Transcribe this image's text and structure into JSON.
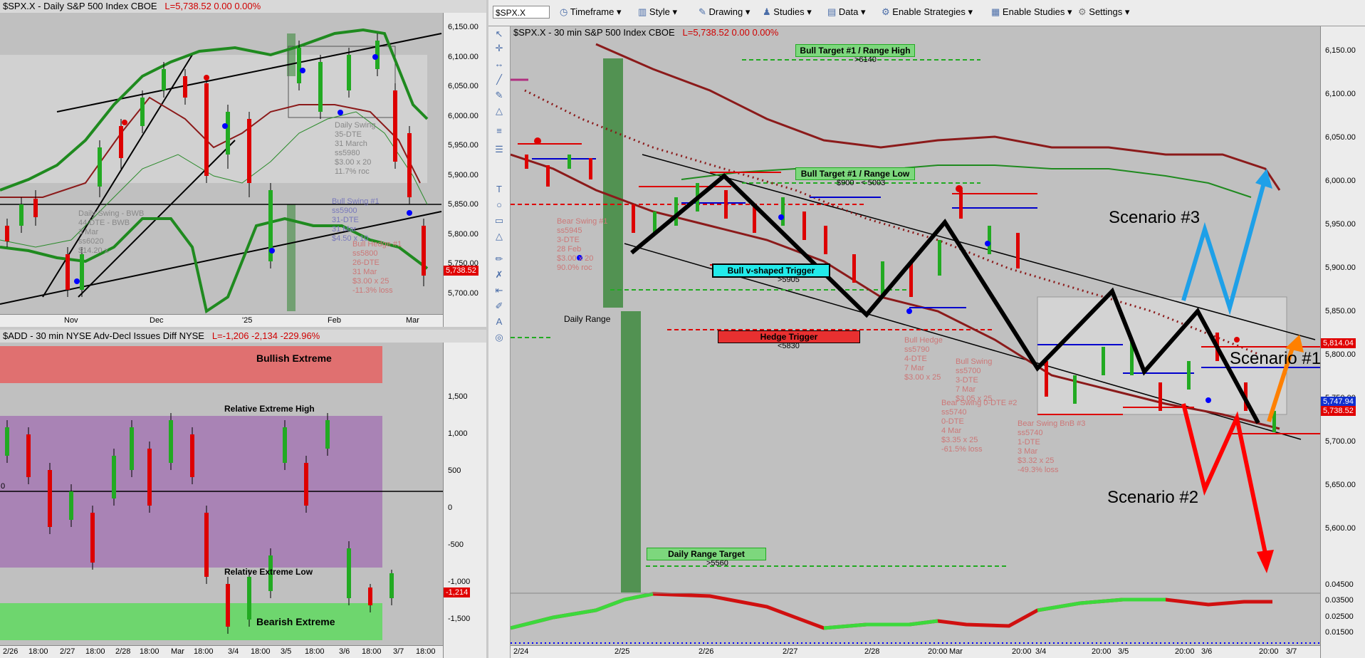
{
  "left_top": {
    "symbol": "$SPX.X - Daily  S&P 500 Index  CBOE",
    "last": "L=5,738.52  0.00  0.00%",
    "y_labels": [
      "6,150.00",
      "6,100.00",
      "6,050.00",
      "6,000.00",
      "5,950.00",
      "5,900.00",
      "5,850.00",
      "5,800.00",
      "5,750.00",
      "5,700.00"
    ],
    "price_tag": "5,738.52",
    "x_labels": [
      "Nov",
      "Dec",
      "'25",
      "Feb",
      "Mar"
    ],
    "notes": {
      "daily_swing_a": "Daily Swing\n35-DTE\n31 March\nss5980\n$3.00 x 20\n11.7% roc",
      "daily_swing_b": "Daily Swing - BWB\n44 DTE - BWB\n3 Mar\nss6020\n$14.20 x",
      "bull_swing": "Bull Swing #1\nss5900\n31-DTE\n31 Mar\n$4.50 x 10",
      "bull_hedge": "Bull Hedge #1\nss5800\n26-DTE\n31 Mar\n$3.00 x 25\n-11.3% loss"
    }
  },
  "left_bottom": {
    "symbol": "$ADD - 30 min  NYSE Adv-Decl Issues Diff  NYSE",
    "last": "L=-1,206  -2,134  -229.96%",
    "y_labels": [
      "1,500",
      "1,000",
      "500",
      "0",
      "-500",
      "-1,000",
      "-1,500"
    ],
    "price_tag": "-1,214",
    "zero_marker": "0",
    "x_labels": [
      "2/26",
      "18:00",
      "2/27",
      "18:00",
      "2/28",
      "18:00",
      "Mar",
      "18:00",
      "3/4",
      "18:00",
      "3/5",
      "18:00",
      "3/6",
      "18:00",
      "3/7",
      "18:00"
    ],
    "bullish_extreme": "Bullish Extreme",
    "bearish_extreme": "Bearish Extreme",
    "rel_high": "Relative Extreme High",
    "rel_low": "Relative Extreme Low"
  },
  "toolbar": {
    "symbol_value": "$SPX.X",
    "timeframe": "Timeframe",
    "style": "Style",
    "drawing": "Drawing",
    "studies": "Studies",
    "data": "Data",
    "enable_strategies": "Enable Strategies",
    "enable_studies": "Enable Studies",
    "settings": "Settings"
  },
  "main": {
    "symbol": "$SPX.X - 30 min  S&P 500 Index  CBOE",
    "last": "L=5,738.52  0.00  0.00%",
    "y_labels": [
      "6,150.00",
      "6,100.00",
      "6,050.00",
      "6,000.00",
      "5,950.00",
      "5,900.00",
      "5,850.00",
      "5,800.00",
      "5,750.00",
      "5,700.00",
      "5,650.00",
      "5,600.00"
    ],
    "tag_red_upper": "5,814.04",
    "tag_blue": "5,747.94",
    "tag_red": "5,738.52",
    "ind_labels": [
      "0.04500",
      "0.03500",
      "0.02500",
      "0.01500"
    ],
    "x_labels": [
      "2/24",
      "2/25",
      "2/26",
      "2/27",
      "2/28",
      "20:00",
      "Mar",
      "20:00",
      "3/4",
      "20:00",
      "3/5",
      "20:00",
      "3/6",
      "20:00",
      "3/7"
    ],
    "bull_target_high": "Bull Target #1 / Range High",
    "bull_target_high_val": ">6140",
    "bull_target_low": "Bull Target #1 / Range Low",
    "bull_target_low_val": "$900 - < 5003",
    "bull_v_trigger": "Bull v-shaped Trigger",
    "bull_v_val": ">5905",
    "hedge_trigger": "Hedge Trigger",
    "hedge_val": "<5830",
    "daily_range": "Daily Range",
    "daily_range_target": "Daily Range Target",
    "daily_range_target_val": ">5560",
    "scenario1": "Scenario #1",
    "scenario2": "Scenario #2",
    "scenario3": "Scenario #3",
    "notes": {
      "bear_swing_a": "Bear Swing #1\nss5945\n3-DTE\n28 Feb\n$3.00 x 20\n90.0% roc",
      "bull_hedge_b": "Bull Hedge\nss5790\n4-DTE\n7 Mar\n$3.00 x 25",
      "bull_swing_b": "Bull Swing\nss5700\n3-DTE\n7 Mar\n$3.05 x 25",
      "bear_swing_0dte": "Bear Swing 0-DTE #2\nss5740\n0-DTE\n4 Mar\n$3.35 x 25\n-61.5% loss",
      "bear_swing_bnb": "Bear Swing BnB #3\nss5740\n1-DTE\n3 Mar\n$3.32 x 25\n-49.3% loss"
    }
  }
}
